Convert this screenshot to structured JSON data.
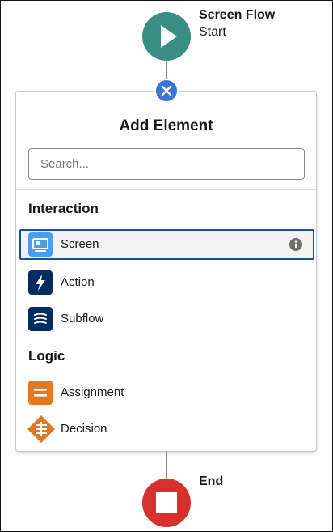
{
  "start_node": {
    "title": "Screen Flow",
    "subtitle": "Start",
    "color": "#3a8f85",
    "icon": "play-icon"
  },
  "add_button": {
    "icon": "close-icon",
    "color": "#3f73d8"
  },
  "panel": {
    "title": "Add Element",
    "search": {
      "placeholder": "Search...",
      "value": ""
    },
    "sections": [
      {
        "title": "Interaction",
        "items": [
          {
            "label": "Screen",
            "icon": "screen-icon",
            "color": "#4a9ef0",
            "selected": true,
            "info_icon": "info-icon"
          },
          {
            "label": "Action",
            "icon": "lightning-icon",
            "color": "#032d60"
          },
          {
            "label": "Subflow",
            "icon": "subflow-icon",
            "color": "#032d60"
          }
        ]
      },
      {
        "title": "Logic",
        "items": [
          {
            "label": "Assignment",
            "icon": "assignment-icon",
            "color": "#dd7a2a"
          },
          {
            "label": "Decision",
            "icon": "decision-icon",
            "color": "#dd7a2a"
          }
        ]
      }
    ]
  },
  "end_node": {
    "title": "End",
    "color": "#d6302f",
    "icon": "stop-icon"
  },
  "colors": {
    "selection_border": "#1b5297",
    "panel_border": "#c9c9c9"
  }
}
